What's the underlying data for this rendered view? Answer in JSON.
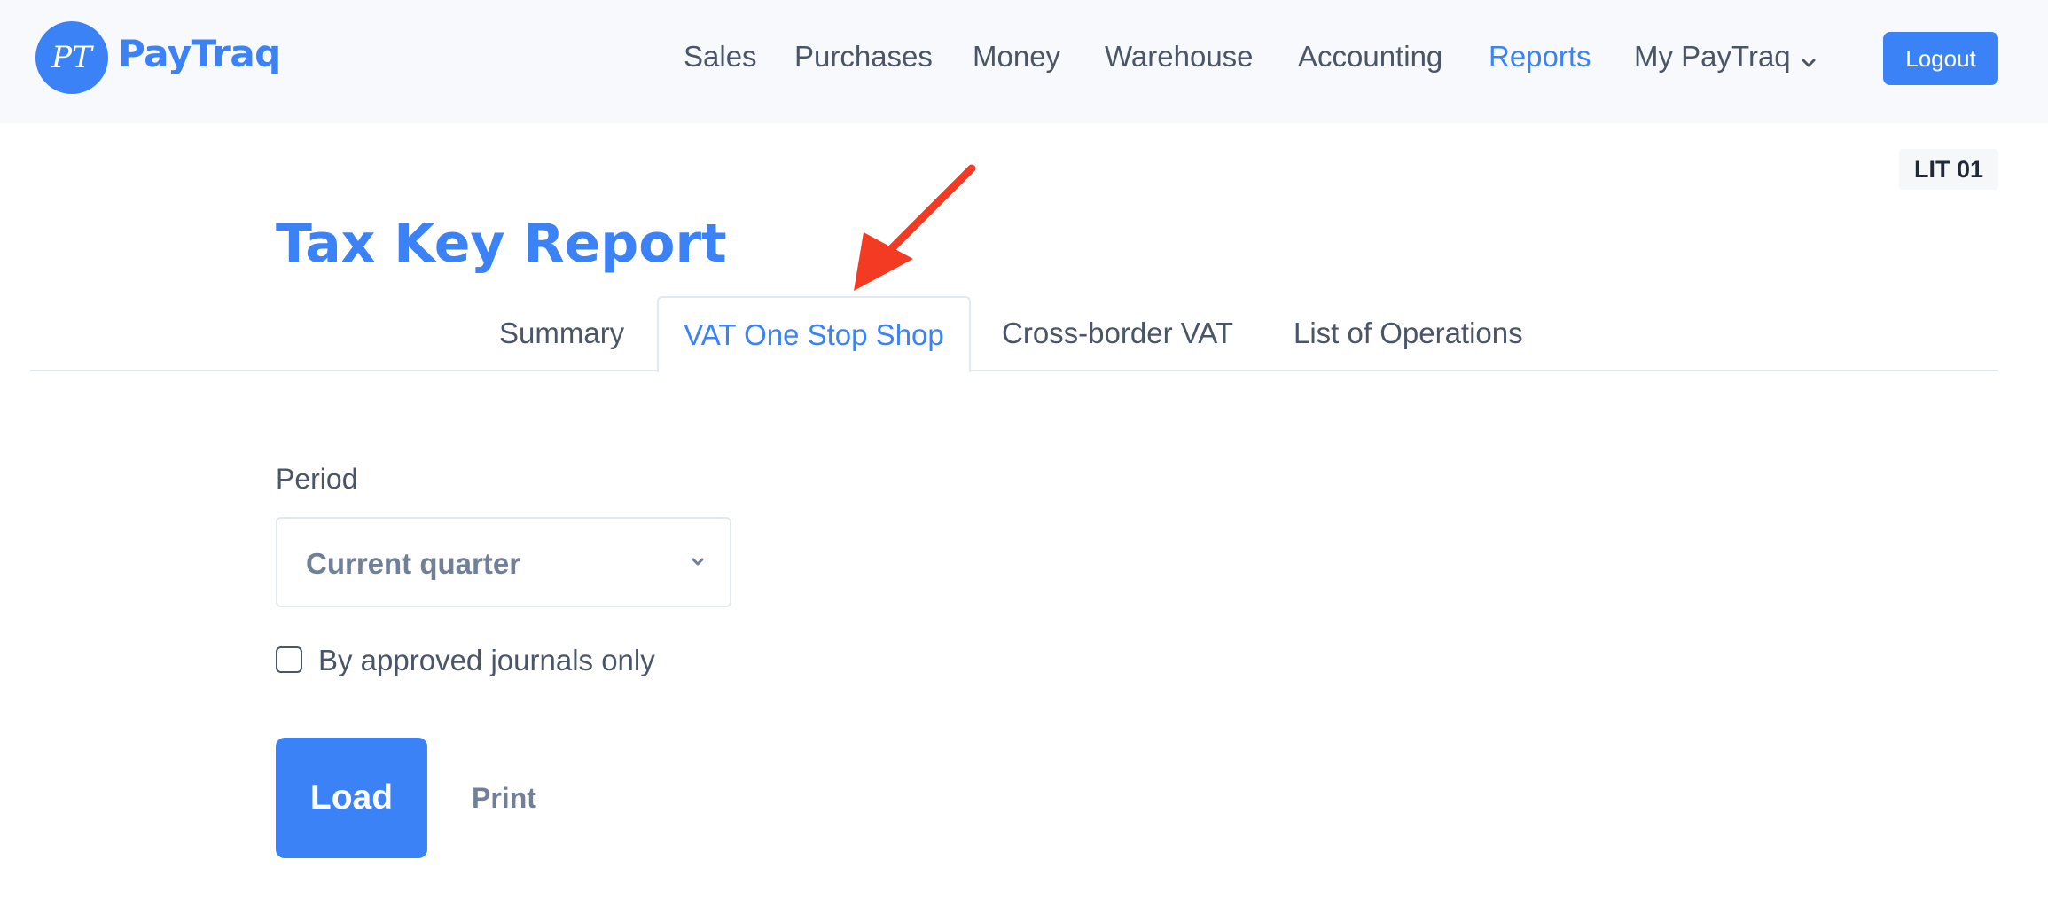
{
  "header": {
    "logo_text": "PayTraq",
    "logo_monogram": "PT",
    "nav": [
      {
        "label": "Sales",
        "active": false
      },
      {
        "label": "Purchases",
        "active": false
      },
      {
        "label": "Money",
        "active": false
      },
      {
        "label": "Warehouse",
        "active": false
      },
      {
        "label": "Accounting",
        "active": false
      },
      {
        "label": "Reports",
        "active": true
      },
      {
        "label": "My PayTraq",
        "active": false,
        "has_dropdown": true,
        "icon": "chevron-down-icon"
      }
    ],
    "logout_label": "Logout"
  },
  "badge": "LIT 01",
  "page_title": "Tax Key Report",
  "tabs": [
    {
      "label": "Summary",
      "active": false
    },
    {
      "label": "VAT One Stop Shop",
      "active": true
    },
    {
      "label": "Cross-border VAT",
      "active": false
    },
    {
      "label": "List of Operations",
      "active": false
    }
  ],
  "form": {
    "period_label": "Period",
    "period_selected": "Current quarter",
    "approved_only_label": "By approved journals only",
    "approved_only_checked": false,
    "load_label": "Load",
    "print_label": "Print"
  },
  "colors": {
    "brand": "#3b82f6",
    "header_bg": "#f8f9fd",
    "text": "#4a5568",
    "muted": "#718096",
    "annotation_arrow": "#f23b22"
  }
}
